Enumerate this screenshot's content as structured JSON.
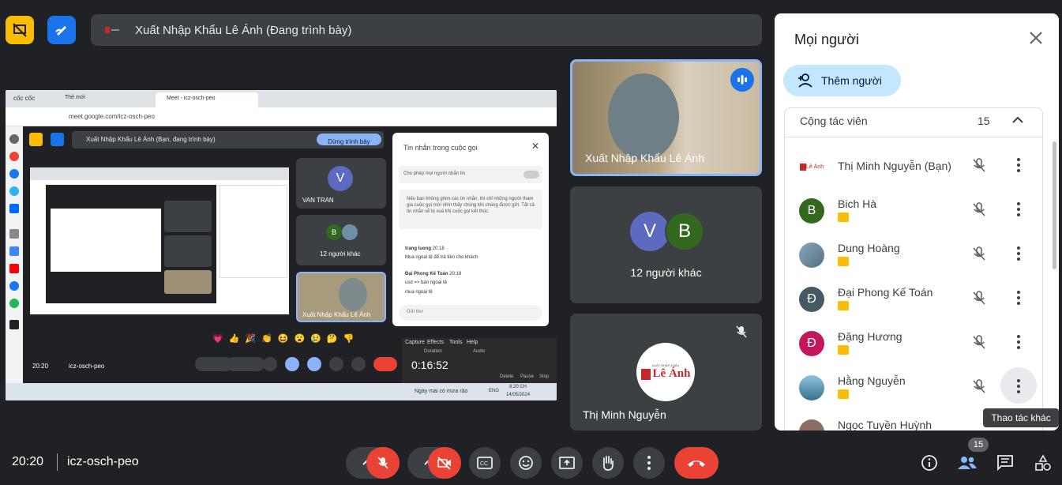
{
  "presentation_bar": {
    "title": "Xuất Nhập Khẩu Lê Ánh (Đang trình bày)"
  },
  "shared_screen": {
    "browser_brand": "cốc cốc",
    "tab_new": "Thẻ mới",
    "tab_meet": "Meet - icz-osch-peo",
    "url": "meet.google.com/icz-osch-peo",
    "inner_pres_title": "Xuất Nhập Khẩu Lê Ánh (Bạn, đang trình bày)",
    "stop_presenting": "Dừng trình bày",
    "inner_tile1": "VAN TRAN",
    "inner_tile2": "12 người khác",
    "inner_tile3": "Xuất Nhập Khẩu Lê Ánh",
    "chat_title": "Tin nhắn trong cuộc gọi",
    "chat_toggle": "Cho phép mọi người nhắn tin",
    "chat_notice": "Nếu bạn không ghim các tin nhắn, thì chỉ những người tham gia cuộc gọi mới nhìn thấy chúng khi chúng được gửi. Tất cả tin nhắn sẽ bị xoá khi cuộc gọi kết thúc.",
    "chat_messages": [
      {
        "author": "trang luong",
        "time": "20:18",
        "text": "Mua ngoại tệ để trả tiền cho khách"
      },
      {
        "author": "Đại Phong Kế Toán",
        "time": "20:18",
        "text": "usd => bán ngoại tệ"
      },
      {
        "author": "",
        "time": "",
        "text": "mua ngoại tệ"
      }
    ],
    "chat_input_placeholder": "Gửi thư",
    "inner_time": "20:20",
    "inner_code": "icz-osch-peo",
    "recorder_menu": [
      "Capture",
      "Effects",
      "Tools",
      "Help"
    ],
    "recorder_duration_label": "Duration",
    "recorder_audio_label": "Audio",
    "recorder_time": "0:16:52",
    "recorder_delete": "Delete",
    "recorder_pause": "Pause",
    "recorder_stop": "Stop",
    "taskbar_weather": "Ngày mai có mưa rào",
    "taskbar_lang": "ENG",
    "taskbar_time": "8:20 CH",
    "taskbar_date": "14/05/2024"
  },
  "tiles": {
    "presenter_name": "Xuất Nhập Khẩu Lê Ánh",
    "others_avatar1": "V",
    "others_avatar2": "B",
    "others_label": "12 người khác",
    "self_name": "Thị Minh Nguyễn",
    "self_logo_small": "XUẤT NHẬP KHẨU",
    "self_logo_big": "Lê Ánh"
  },
  "panel": {
    "title": "Mọi người",
    "add_button": "Thêm người",
    "section_title": "Cộng tác viên",
    "section_count": "15",
    "people": [
      {
        "name": "Thị Minh Nguyễn (Bạn)",
        "initial": "",
        "color": "#ffffff"
      },
      {
        "name": "Bich Hà",
        "initial": "B",
        "color": "#33691e"
      },
      {
        "name": "Dung Hoàng",
        "initial": "",
        "color": "#6d8fa8"
      },
      {
        "name": "Đại Phong Kế Toán",
        "initial": "Đ",
        "color": "#455a64"
      },
      {
        "name": "Đặng Hương",
        "initial": "Đ",
        "color": "#c2185b"
      },
      {
        "name": "Hằng Nguyễn",
        "initial": "",
        "color": "#4a86a8"
      },
      {
        "name": "Ngọc Tuyền Huỳnh",
        "initial": "",
        "color": "#8d6e63"
      }
    ],
    "tooltip": "Thao tác khác"
  },
  "bottom_bar": {
    "time": "20:20",
    "meeting_code": "icz-osch-peo",
    "people_count": "15"
  },
  "colors": {
    "accent": "#8ab4f8",
    "end_call": "#ea4335",
    "panel_button": "#c2e7ff"
  }
}
